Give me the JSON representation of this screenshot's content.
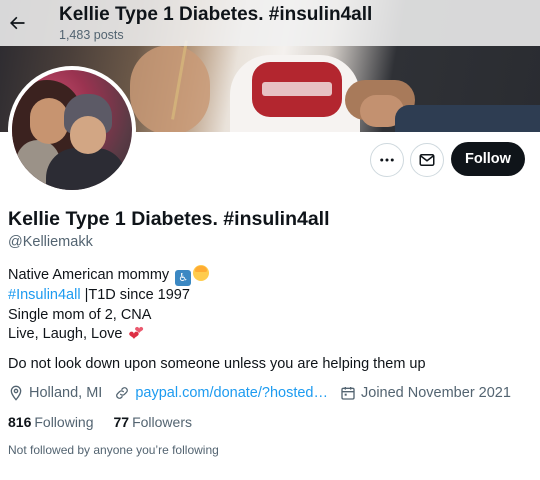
{
  "header": {
    "title": "Kellie Type 1 Diabetes. #insulin4all",
    "posts_count": "1,483 posts",
    "back_icon": "arrow-left-icon"
  },
  "profile": {
    "name": "Kellie Type 1 Diabetes. #insulin4all",
    "handle": "@Kelliemakk",
    "bio": {
      "line1": "Native American mommy",
      "line1_emojis": [
        "wheelchair-emoji",
        "blond-person-emoji"
      ],
      "hashtag": "#Insulin4all",
      "line2_rest": " |T1D since 1997",
      "line3": "Single mom of 2, CNA",
      "line4": "Live, Laugh, Love",
      "line4_emoji": "revolving-hearts-emoji"
    },
    "quote": "Do not look down upon someone unless you are helping them up",
    "location": "Holland, MI",
    "link": "paypal.com/donate/?hosted…",
    "joined": "Joined November 2021",
    "following_count": "816",
    "following_label": "Following",
    "followers_count": "77",
    "followers_label": "Followers",
    "followed_by": "Not followed by anyone you’re following"
  },
  "actions": {
    "follow_label": "Follow",
    "more_icon": "more-icon",
    "message_icon": "envelope-icon"
  },
  "colors": {
    "accent": "#1d9bf0",
    "text_primary": "#0f1419",
    "text_secondary": "#536471",
    "follow_bg": "#0f1419"
  }
}
